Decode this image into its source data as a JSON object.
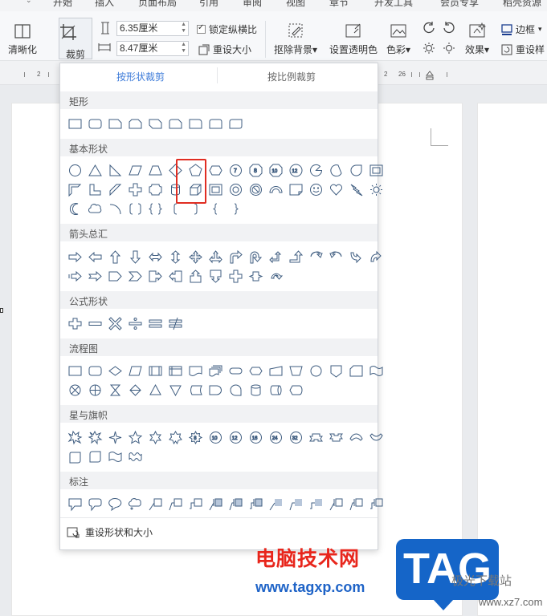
{
  "tabs": [
    "开始",
    "插入",
    "页面布局",
    "引用",
    "审阅",
    "视图",
    "章节",
    "开发工具",
    "会员专享",
    "稻壳资源"
  ],
  "ribbon": {
    "sharpen": "清晰化",
    "crop": "裁剪",
    "width": "6.35厘米",
    "height": "8.47厘米",
    "lock_ratio": "锁定纵横比",
    "reset_size": "重设大小",
    "remove_bg": "抠除背景",
    "set_transparent": "设置透明色",
    "color": "色彩",
    "effects": "效果",
    "border": "边框",
    "reset_style": "重设样"
  },
  "ruler": {
    "left_tick": "2",
    "ticks": [
      "2",
      "26"
    ]
  },
  "crop_panel": {
    "tab_shape": "按形状裁剪",
    "tab_ratio": "按比例裁剪",
    "sections": {
      "rect": "矩形",
      "basic": "基本形状",
      "arrows": "箭头总汇",
      "formula": "公式形状",
      "flowchart": "流程图",
      "stars": "星与旗帜",
      "callouts": "标注"
    },
    "reset": "重设形状和大小"
  },
  "watermark": {
    "brand": "电脑技术网",
    "url": "www.tagxp.com",
    "tag": "TAG",
    "site": "极光下载站",
    "site_url": "www.xz7.com"
  },
  "colors": {
    "accent": "#3d7bd9",
    "highlight": "#e02d22",
    "shape_stroke": "#3f5d80",
    "watermark_red": "#e8261c",
    "watermark_blue": "#1e63c7"
  }
}
